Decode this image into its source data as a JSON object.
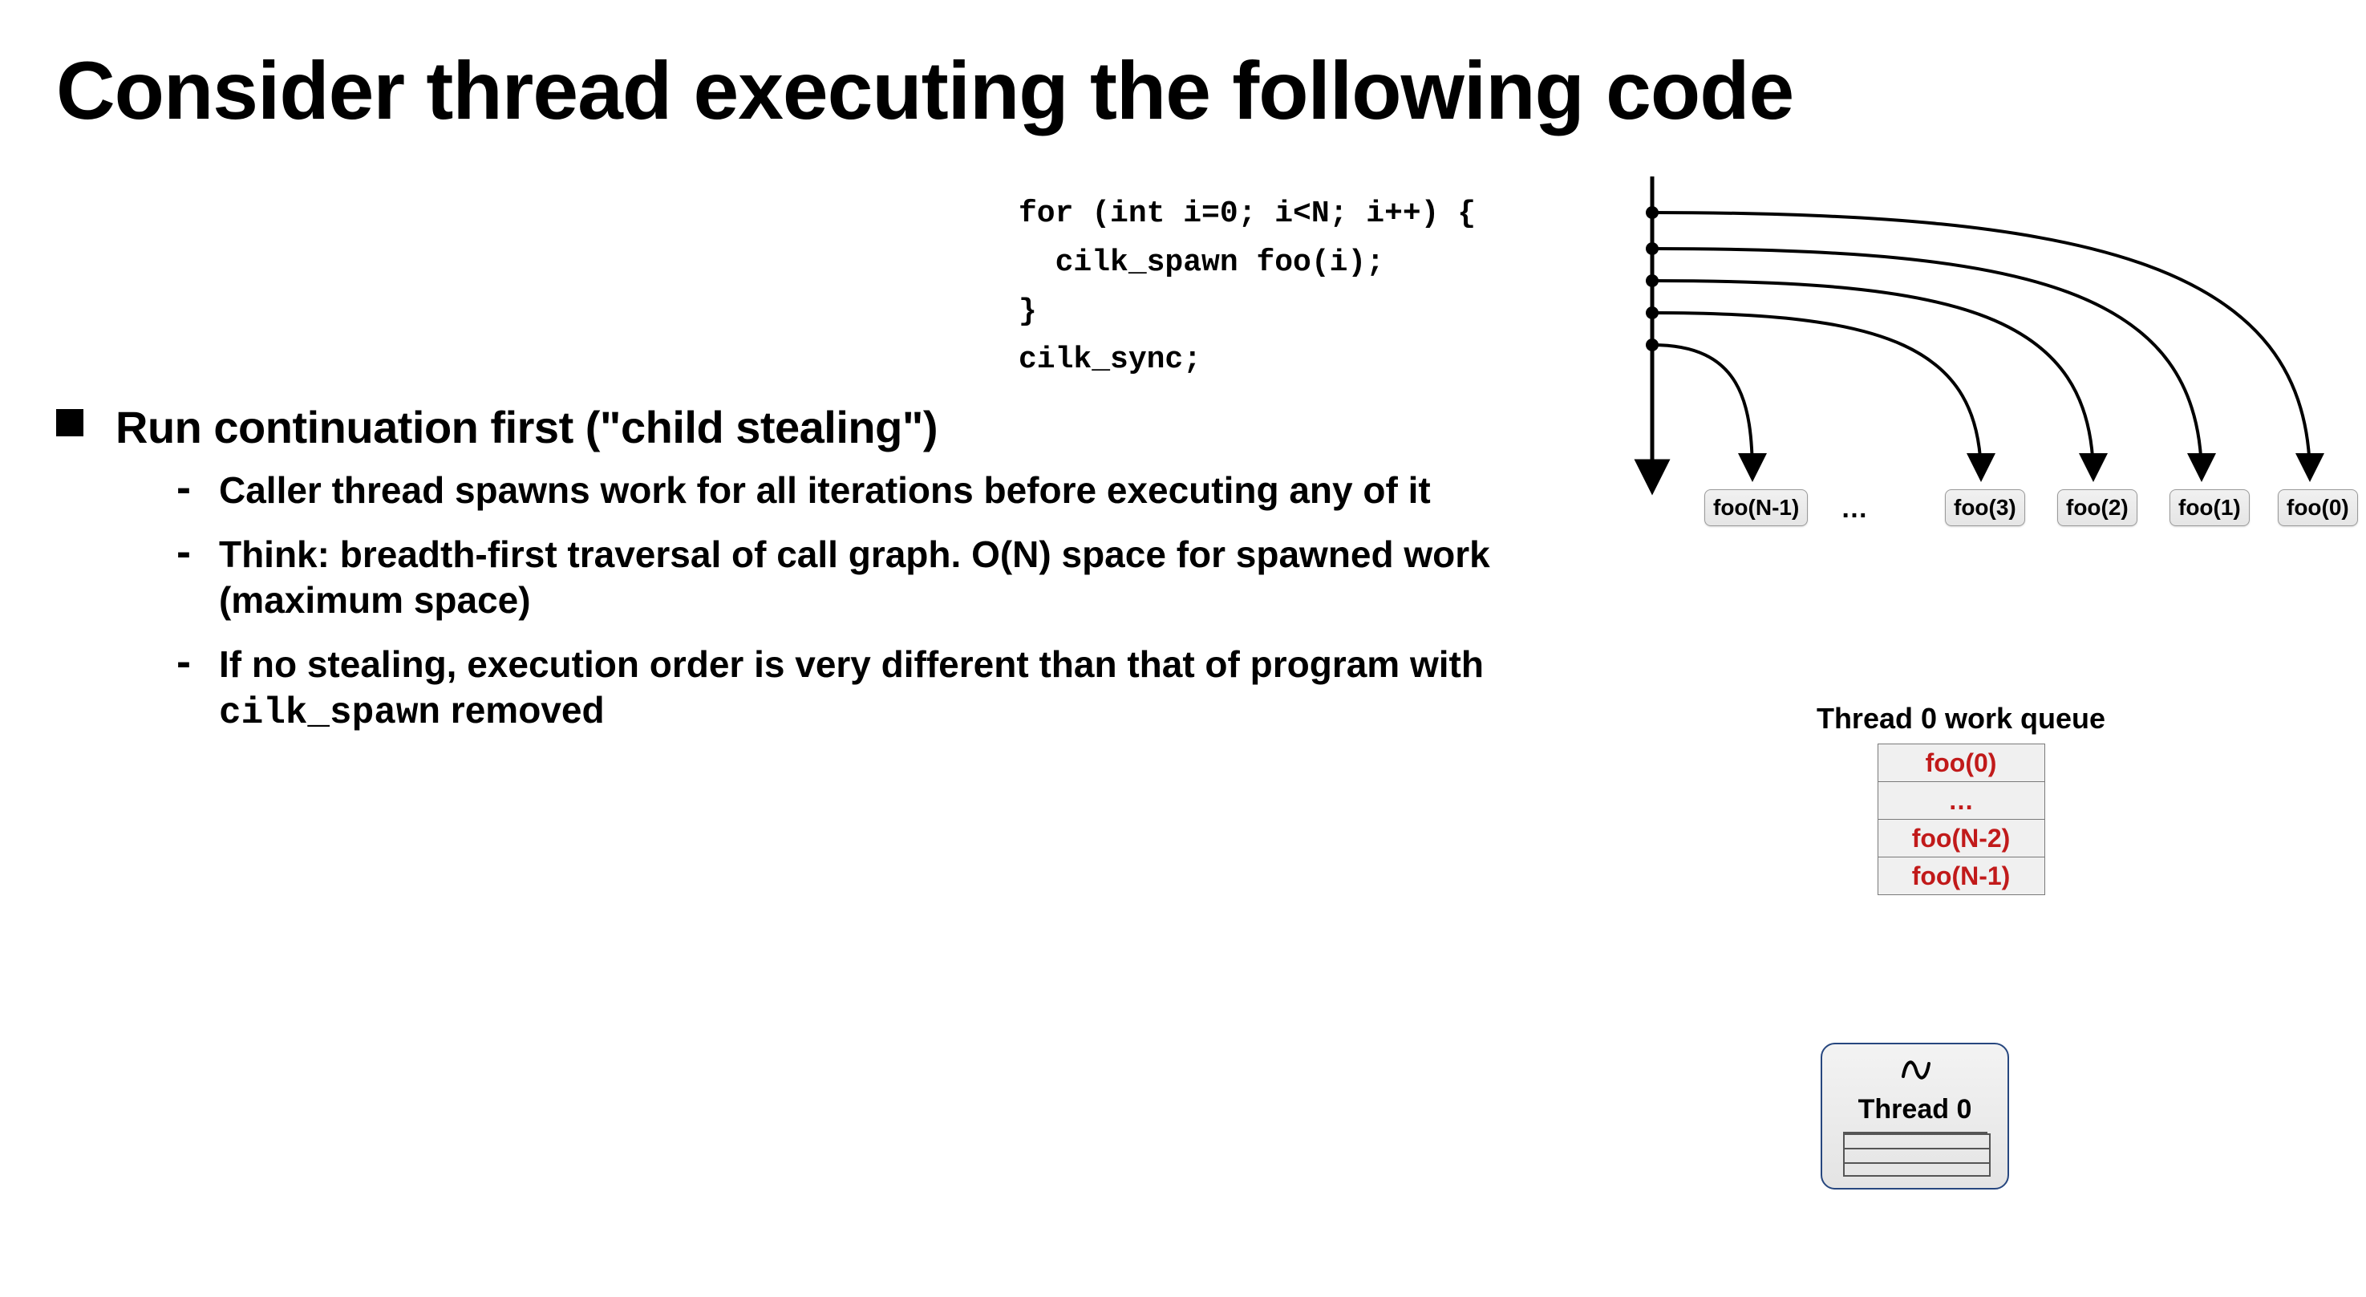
{
  "title": "Consider thread executing the following code",
  "code": {
    "line1": "for (int i=0; i<N; i++) {",
    "line2": "  cilk_spawn foo(i);",
    "line3": "}",
    "line4": "cilk_sync;"
  },
  "diagram": {
    "nodes": [
      "foo(N-1)",
      "foo(3)",
      "foo(2)",
      "foo(1)",
      "foo(0)"
    ],
    "ellipsis": "…"
  },
  "bullet": {
    "heading": "Run continuation first (\"child stealing\")",
    "items": [
      "Caller thread spawns work for all iterations before executing any of it",
      "Think: breadth-first traversal of call graph. O(N) space for spawned work (maximum space)",
      "If no stealing, execution order is very different than that of program with "
    ],
    "item3_mono": "cilk_spawn",
    "item3_tail": " removed"
  },
  "workqueue": {
    "title": "Thread 0 work queue",
    "rows": [
      "foo(0)",
      "…",
      "foo(N-2)",
      "foo(N-1)"
    ]
  },
  "thread": {
    "squiggle": "∼",
    "label": "Thread 0"
  }
}
